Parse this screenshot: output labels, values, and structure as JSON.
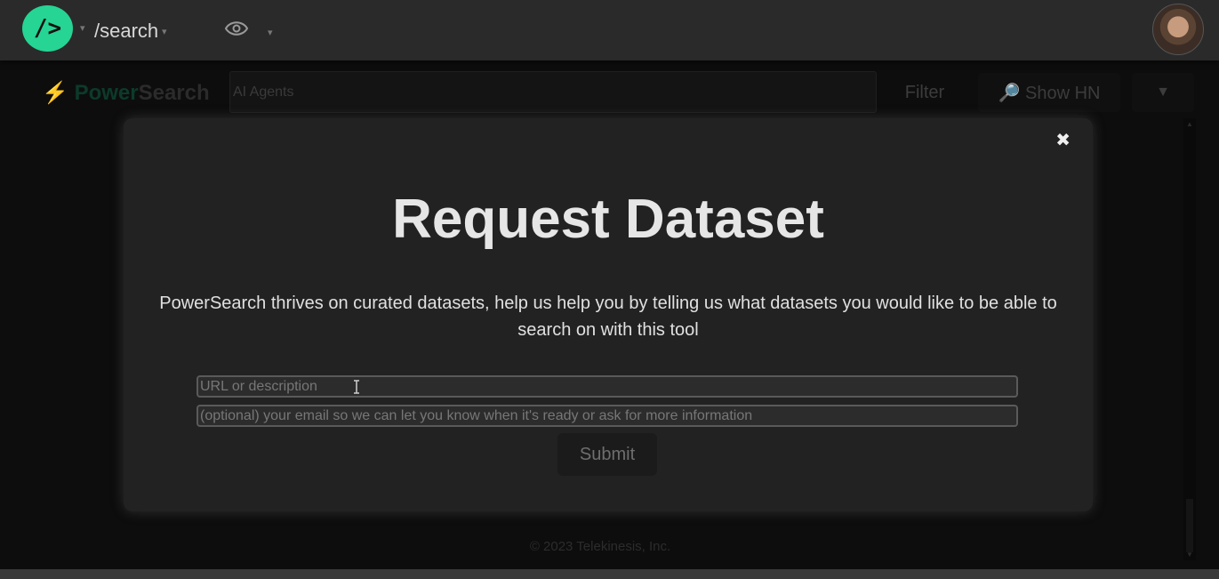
{
  "topbar": {
    "logo_text": "/>",
    "route": "/search",
    "caret": "▾"
  },
  "background_app": {
    "brand_bolt": "⚡",
    "brand_power": "Power",
    "brand_search": "Search",
    "search_value": "AI Agents",
    "filter_label": "Filter",
    "show_hn_label": "🔎 Show HN",
    "menu_caret": "▼",
    "footer": "© 2023 Telekinesis, Inc."
  },
  "modal": {
    "close": "✖",
    "title": "Request Dataset",
    "description": "PowerSearch thrives on curated datasets, help us help you by telling us what datasets you would like to be able to search on with this tool",
    "url_placeholder": "URL or description",
    "email_placeholder": "(optional) your email so we can let you know when it's ready or ask for more information",
    "submit_label": "Submit"
  },
  "colors": {
    "accent": "#26d494",
    "modal_bg": "#222222",
    "page_bg": "#0d0d0d"
  }
}
